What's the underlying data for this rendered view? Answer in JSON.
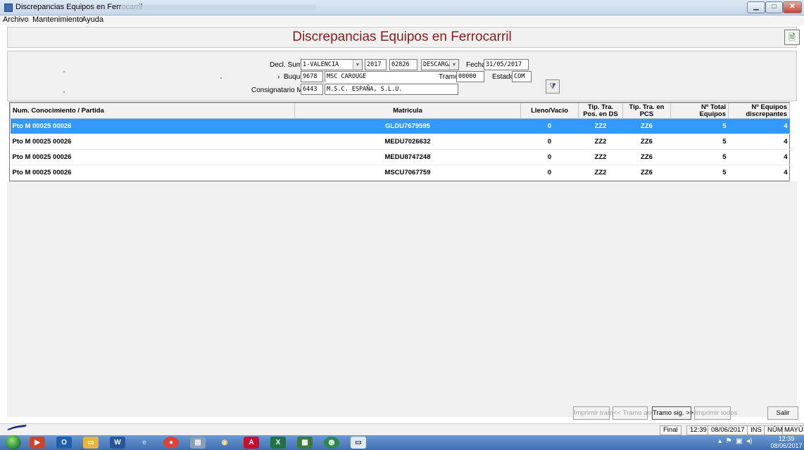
{
  "window": {
    "title": "Discrepancias Equipos en Ferrocarril"
  },
  "menu": [
    "Archivo",
    "Mantenimiento",
    "Ayuda"
  ],
  "heading": "Discrepancias Equipos en Ferrocarril",
  "form": {
    "decl_sumaria_label": "Decl. Sumaria",
    "decl_sumaria_value": "1-VALENCIA",
    "year": "2017",
    "number": "02826",
    "operation": "DESCARGA",
    "fecha_label": "Fecha",
    "fecha_value": "31/05/2017",
    "buque_label": "Buque",
    "buque_code": "9678",
    "buque_name": "MSC CAROUGE",
    "tramo_label": "Tramo",
    "tramo_value": "00000",
    "estado_label": "Estado",
    "estado_value": "COM",
    "consignatario_label": "Consignatario Mer",
    "consignatario_code": "6443",
    "consignatario_name": "M.S.C. ESPAÑA, S.L.U."
  },
  "table": {
    "headers": [
      "Num. Conocimiento / Partida",
      "Matricula",
      "Lleno/Vacio",
      "Tip. Tra. Pos. en DS",
      "Tip. Tra. en PCS",
      "Nº Total Equipos",
      "Nº Equipos discrepantes"
    ],
    "rows": [
      [
        "Pto M 00025 00026",
        "GLDU7679595",
        "0",
        "ZZ2",
        "ZZ6",
        "5",
        "4"
      ],
      [
        "Pto M 00025 00026",
        "MEDU7026632",
        "0",
        "ZZ2",
        "ZZ6",
        "5",
        "4"
      ],
      [
        "Pto M 00025 00026",
        "MEDU8747248",
        "0",
        "ZZ2",
        "ZZ6",
        "5",
        "4"
      ],
      [
        "Pto M 00025 00026",
        "MSCU7067759",
        "0",
        "ZZ2",
        "ZZ6",
        "5",
        "4"
      ]
    ]
  },
  "buttons": {
    "imprimir_tramo": "Imprimir tramo",
    "tramo_ant": "<< Tramo ant",
    "tramo_sig": "Tramo sig. >>",
    "imprimir_todos": "Imprimir todos",
    "salir": "Salir"
  },
  "status": {
    "mode": "Final",
    "time": "12:39",
    "date": "08/06/2017",
    "ins": "INS",
    "num": "NÚM",
    "mayus": "MAYÚS"
  },
  "taskbar": {
    "clock_time": "12:39",
    "clock_date": "08/06/2017"
  },
  "colors": {
    "heading": "#8b1b1b",
    "selection": "#3399ff"
  }
}
